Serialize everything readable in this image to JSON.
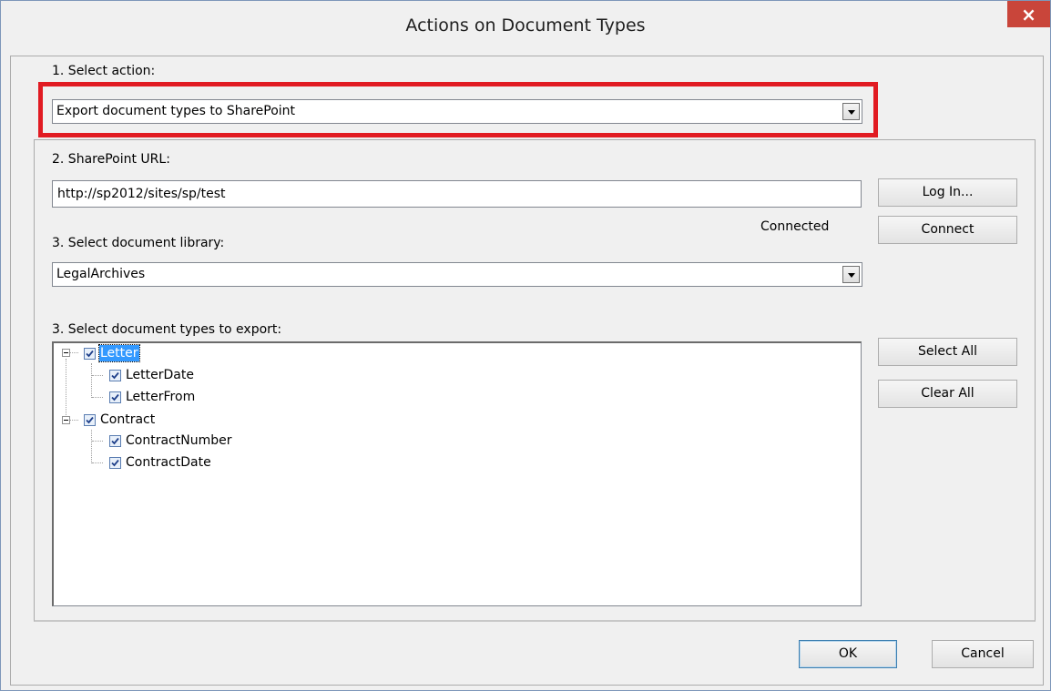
{
  "window": {
    "title": "Actions on Document Types",
    "close_symbol": "×"
  },
  "step1": {
    "label": "1. Select action:",
    "selected": "Export document types to SharePoint"
  },
  "step2": {
    "label": "2. SharePoint URL:",
    "url_value": "http://sp2012/sites/sp/test",
    "login_label": "Log In...",
    "status": "Connected",
    "connect_label": "Connect"
  },
  "step3": {
    "label": "3. Select document library:",
    "selected": "LegalArchives"
  },
  "step4": {
    "label": "3. Select document types to export:",
    "select_all_label": "Select All",
    "clear_all_label": "Clear All",
    "tree": [
      {
        "label": "Letter",
        "checked": true,
        "expanded": true,
        "selected": true
      },
      {
        "label": "LetterDate",
        "checked": true
      },
      {
        "label": "LetterFrom",
        "checked": true
      },
      {
        "label": "Contract",
        "checked": true,
        "expanded": true,
        "selected": false
      },
      {
        "label": "ContractNumber",
        "checked": true
      },
      {
        "label": "ContractDate",
        "checked": true
      }
    ]
  },
  "footer": {
    "ok_label": "OK",
    "cancel_label": "Cancel"
  },
  "colors": {
    "highlight_border": "#e11b22",
    "close_button": "#c9453a",
    "selection": "#3399ff"
  },
  "icons": [
    "close-icon",
    "dropdown-arrow-icon",
    "checkbox-checked-icon",
    "tree-collapse-icon"
  ]
}
